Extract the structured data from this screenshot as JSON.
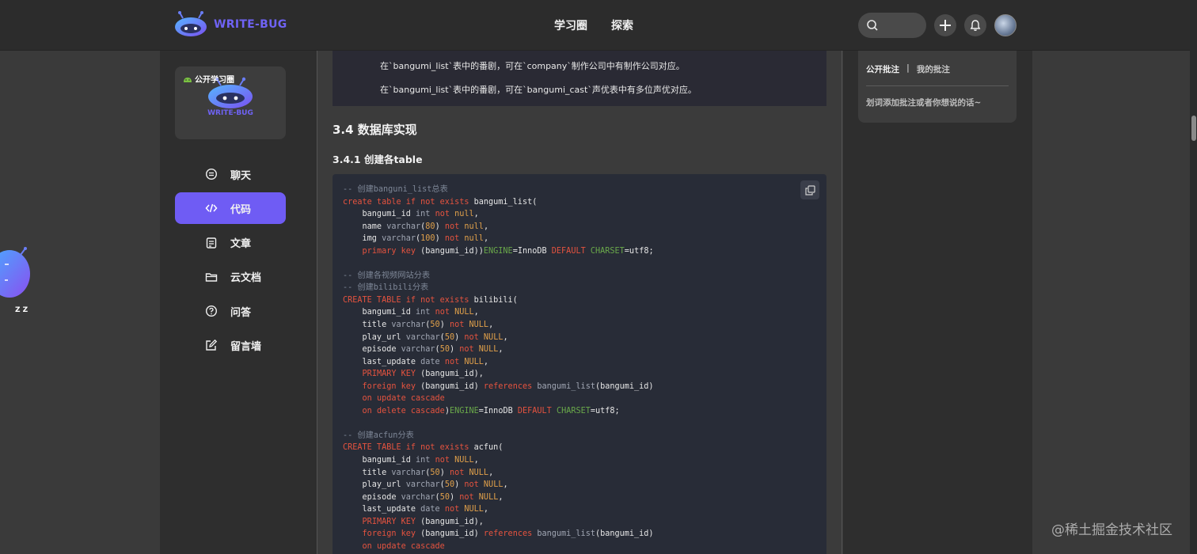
{
  "header": {
    "brand_name": "WRITE-BUG",
    "nav": [
      "学习圈",
      "探索"
    ],
    "accent_color": "#6f5cf4"
  },
  "sidebar": {
    "circle_tag": "公开学习圈",
    "circle_logo_text": "WRITE-BUG",
    "items": [
      {
        "label": "聊天",
        "icon": "chat-icon",
        "active": false
      },
      {
        "label": "代码",
        "icon": "code-icon",
        "active": true
      },
      {
        "label": "文章",
        "icon": "article-icon",
        "active": false
      },
      {
        "label": "云文档",
        "icon": "folder-icon",
        "active": false
      },
      {
        "label": "问答",
        "icon": "question-icon",
        "active": false
      },
      {
        "label": "留言墙",
        "icon": "edit-icon",
        "active": false
      }
    ]
  },
  "article": {
    "quote_lines": [
      "在`bangumi_list`表中的番剧，可在`company`制作公司中有制作公司对应。",
      "在`bangumi_list`表中的番剧，可在`bangumi_cast`声优表中有多位声优对应。"
    ],
    "h3": "3.4 数据库实现",
    "h4": "3.4.1 创建各table",
    "code_lines": [
      [
        [
          "comment",
          "-- 创建banguni_list总表"
        ]
      ],
      [
        [
          "keyword",
          "create table if not exists "
        ],
        [
          "plain",
          "bangumi_list("
        ]
      ],
      [
        [
          "plain",
          "    bangumi_id "
        ],
        [
          "type",
          "int "
        ],
        [
          "keyword",
          "not "
        ],
        [
          "number",
          "null"
        ],
        [
          "plain",
          ","
        ]
      ],
      [
        [
          "plain",
          "    name "
        ],
        [
          "type",
          "varchar"
        ],
        [
          "plain",
          "("
        ],
        [
          "number",
          "80"
        ],
        [
          "plain",
          ") "
        ],
        [
          "keyword",
          "not "
        ],
        [
          "number",
          "null"
        ],
        [
          "plain",
          ","
        ]
      ],
      [
        [
          "plain",
          "    img "
        ],
        [
          "type",
          "varchar"
        ],
        [
          "plain",
          "("
        ],
        [
          "number",
          "100"
        ],
        [
          "plain",
          ") "
        ],
        [
          "keyword",
          "not "
        ],
        [
          "number",
          "null"
        ],
        [
          "plain",
          ","
        ]
      ],
      [
        [
          "plain",
          "    "
        ],
        [
          "keyword",
          "primary key "
        ],
        [
          "plain",
          "(bangumi_id))"
        ],
        [
          "string",
          "ENGINE"
        ],
        [
          "plain",
          "=InnoDB "
        ],
        [
          "keyword",
          "DEFAULT "
        ],
        [
          "string",
          "CHARSET"
        ],
        [
          "plain",
          "=utf8;"
        ]
      ],
      [],
      [
        [
          "comment",
          "-- 创建各视频网站分表"
        ]
      ],
      [
        [
          "comment",
          "-- 创建bilibili分表"
        ]
      ],
      [
        [
          "keyword",
          "CREATE TABLE if not exists "
        ],
        [
          "plain",
          "bilibili("
        ]
      ],
      [
        [
          "plain",
          "    bangumi_id "
        ],
        [
          "type",
          "int "
        ],
        [
          "keyword",
          "not "
        ],
        [
          "number",
          "NULL"
        ],
        [
          "plain",
          ","
        ]
      ],
      [
        [
          "plain",
          "    title "
        ],
        [
          "type",
          "varchar"
        ],
        [
          "plain",
          "("
        ],
        [
          "number",
          "50"
        ],
        [
          "plain",
          ") "
        ],
        [
          "keyword",
          "not "
        ],
        [
          "number",
          "NULL"
        ],
        [
          "plain",
          ","
        ]
      ],
      [
        [
          "plain",
          "    play_url "
        ],
        [
          "type",
          "varchar"
        ],
        [
          "plain",
          "("
        ],
        [
          "number",
          "50"
        ],
        [
          "plain",
          ") "
        ],
        [
          "keyword",
          "not "
        ],
        [
          "number",
          "NULL"
        ],
        [
          "plain",
          ","
        ]
      ],
      [
        [
          "plain",
          "    episode "
        ],
        [
          "type",
          "varchar"
        ],
        [
          "plain",
          "("
        ],
        [
          "number",
          "50"
        ],
        [
          "plain",
          ") "
        ],
        [
          "keyword",
          "not "
        ],
        [
          "number",
          "NULL"
        ],
        [
          "plain",
          ","
        ]
      ],
      [
        [
          "plain",
          "    last_update "
        ],
        [
          "type",
          "date "
        ],
        [
          "keyword",
          "not "
        ],
        [
          "number",
          "NULL"
        ],
        [
          "plain",
          ","
        ]
      ],
      [
        [
          "plain",
          "    "
        ],
        [
          "keyword",
          "PRIMARY KEY "
        ],
        [
          "plain",
          "(bangumi_id),"
        ]
      ],
      [
        [
          "plain",
          "    "
        ],
        [
          "keyword",
          "foreign key "
        ],
        [
          "plain",
          "(bangumi_id) "
        ],
        [
          "keyword",
          "references "
        ],
        [
          "type",
          "bangumi_list"
        ],
        [
          "plain",
          "(bangumi_id)"
        ]
      ],
      [
        [
          "plain",
          "    "
        ],
        [
          "keyword",
          "on update cascade"
        ]
      ],
      [
        [
          "plain",
          "    "
        ],
        [
          "keyword",
          "on delete cascade"
        ],
        [
          "plain",
          ")"
        ],
        [
          "string",
          "ENGINE"
        ],
        [
          "plain",
          "=InnoDB "
        ],
        [
          "keyword",
          "DEFAULT "
        ],
        [
          "string",
          "CHARSET"
        ],
        [
          "plain",
          "=utf8;"
        ]
      ],
      [],
      [
        [
          "comment",
          "-- 创建acfun分表"
        ]
      ],
      [
        [
          "keyword",
          "CREATE TABLE if not exists "
        ],
        [
          "plain",
          "acfun("
        ]
      ],
      [
        [
          "plain",
          "    bangumi_id "
        ],
        [
          "type",
          "int "
        ],
        [
          "keyword",
          "not "
        ],
        [
          "number",
          "NULL"
        ],
        [
          "plain",
          ","
        ]
      ],
      [
        [
          "plain",
          "    title "
        ],
        [
          "type",
          "varchar"
        ],
        [
          "plain",
          "("
        ],
        [
          "number",
          "50"
        ],
        [
          "plain",
          ") "
        ],
        [
          "keyword",
          "not "
        ],
        [
          "number",
          "NULL"
        ],
        [
          "plain",
          ","
        ]
      ],
      [
        [
          "plain",
          "    play_url "
        ],
        [
          "type",
          "varchar"
        ],
        [
          "plain",
          "("
        ],
        [
          "number",
          "50"
        ],
        [
          "plain",
          ") "
        ],
        [
          "keyword",
          "not "
        ],
        [
          "number",
          "NULL"
        ],
        [
          "plain",
          ","
        ]
      ],
      [
        [
          "plain",
          "    episode "
        ],
        [
          "type",
          "varchar"
        ],
        [
          "plain",
          "("
        ],
        [
          "number",
          "50"
        ],
        [
          "plain",
          ") "
        ],
        [
          "keyword",
          "not "
        ],
        [
          "number",
          "NULL"
        ],
        [
          "plain",
          ","
        ]
      ],
      [
        [
          "plain",
          "    last_update "
        ],
        [
          "type",
          "date "
        ],
        [
          "keyword",
          "not "
        ],
        [
          "number",
          "NULL"
        ],
        [
          "plain",
          ","
        ]
      ],
      [
        [
          "plain",
          "    "
        ],
        [
          "keyword",
          "PRIMARY KEY "
        ],
        [
          "plain",
          "(bangumi_id),"
        ]
      ],
      [
        [
          "plain",
          "    "
        ],
        [
          "keyword",
          "foreign key "
        ],
        [
          "plain",
          "(bangumi_id) "
        ],
        [
          "keyword",
          "references "
        ],
        [
          "type",
          "bangumi_list"
        ],
        [
          "plain",
          "(bangumi_id)"
        ]
      ],
      [
        [
          "plain",
          "    "
        ],
        [
          "keyword",
          "on update cascade"
        ]
      ]
    ]
  },
  "annotations": {
    "tab_public": "公开批注",
    "separator": "|",
    "tab_mine": "我的批注",
    "hint": "划词添加批注或者你想说的话~"
  },
  "watermark": "@稀土掘金技术社区",
  "mascot_zz": "Z Z"
}
